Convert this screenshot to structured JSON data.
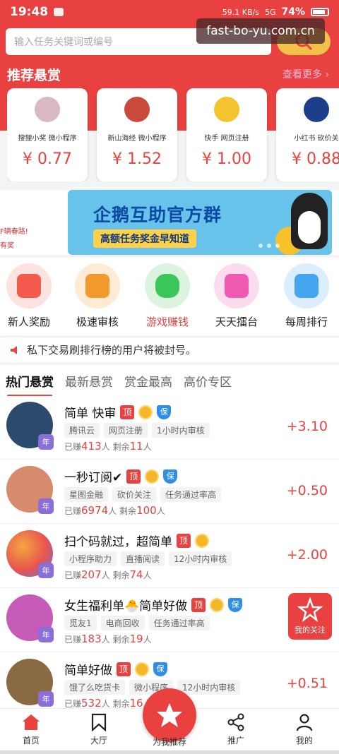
{
  "status": {
    "time": "19:48",
    "net_speed": "59.1 KB/s",
    "signal": "5G",
    "battery": "74%"
  },
  "watermark": "fast-bo-yu.com.cn",
  "search": {
    "placeholder": "输入任务关键词或编号"
  },
  "recommend": {
    "title": "推荐悬赏",
    "more": "查看更多 ›",
    "cards": [
      {
        "tags": "搜狸小奖   微小程序",
        "price": "¥ 0.77",
        "logo_color": "#d9b8c5"
      },
      {
        "tags": "新山海经   微小程序",
        "price": "¥ 1.52",
        "logo_color": "#c94a3a"
      },
      {
        "tags": "快手       网页注册",
        "price": "¥ 1.00",
        "logo_color": "#f4c430"
      },
      {
        "tags": "小红书   砍价关",
        "price": "¥ 0.88",
        "logo_color": "#1d3e8a"
      }
    ]
  },
  "banner": {
    "left_line1": "F辆春路!",
    "left_line2": "有奖",
    "title": "企鹅互助官方群",
    "subtitle": "高额任务奖金早知道"
  },
  "quick_actions": [
    {
      "label": "新人奖励",
      "color": "#f55a4e",
      "bg": "#fde3df",
      "active": false
    },
    {
      "label": "极速审核",
      "color": "#f29a2e",
      "bg": "#fdebd6",
      "active": false
    },
    {
      "label": "游戏赚钱",
      "color": "#3cc65a",
      "bg": "#dbf3df",
      "active": true
    },
    {
      "label": "天天擂台",
      "color": "#ee5ab1",
      "bg": "#fbdcef",
      "active": false
    },
    {
      "label": "每周排行",
      "color": "#43a6ef",
      "bg": "#dcedfb",
      "active": false
    }
  ],
  "notice": "私下交易刷排行榜的用户将被封号。",
  "tabs": [
    "热门悬赏",
    "最新悬赏",
    "赏金最高",
    "高价专区"
  ],
  "tasks": [
    {
      "title": "简单 快审",
      "tags": [
        "腾讯云",
        "网页注册",
        "1小时内审核"
      ],
      "earned_label": "已赚",
      "earned": "413",
      "remain_label": "剩余",
      "remain": "11",
      "unit": "人",
      "reward": "+3.10",
      "has_bao": true,
      "avatar": "#2c4a6e"
    },
    {
      "title": "一秒订阅✔",
      "tags": [
        "星图金融",
        "砍价关注",
        "任务通过率高"
      ],
      "earned_label": "已赚",
      "earned": "6974",
      "remain_label": "剩余",
      "remain": "100",
      "unit": "人",
      "reward": "+0.50",
      "has_bao": true,
      "avatar": "#d88a6c"
    },
    {
      "title": "扫个码就过，超简单",
      "tags": [
        "小程序助力",
        "直播阅读",
        "12小时内审核"
      ],
      "earned_label": "已赚",
      "earned": "207",
      "remain_label": "剩余",
      "remain": "74",
      "unit": "人",
      "reward": "+2.00",
      "has_bao": false,
      "avatar": "#e8544f"
    },
    {
      "title": "女生福利单🐣简单好做",
      "tags": [
        "觅友1",
        "电商回收",
        "任务通过率高"
      ],
      "earned_label": "已赚",
      "earned": "183",
      "remain_label": "剩余",
      "remain": "19",
      "unit": "人",
      "reward": "",
      "has_bao": true,
      "avatar": "#c65cb8"
    },
    {
      "title": "简单好做",
      "tags": [
        "饿了么吃货卡",
        "微小程序",
        "12小时内审核"
      ],
      "earned_label": "已赚",
      "earned": "532",
      "remain_label": "剩余",
      "remain": "16",
      "unit": "人",
      "reward": "+0.51",
      "has_bao": true,
      "avatar": "#8a6a42"
    }
  ],
  "badges": {
    "ding": "顶",
    "bao": "保",
    "nian": "年"
  },
  "follow": "我的关注",
  "bottom_nav": {
    "home": "首页",
    "hall": "大厅",
    "recommend": "为我推荐",
    "promote": "推广",
    "mine": "我的"
  },
  "accent": "#e8413f"
}
